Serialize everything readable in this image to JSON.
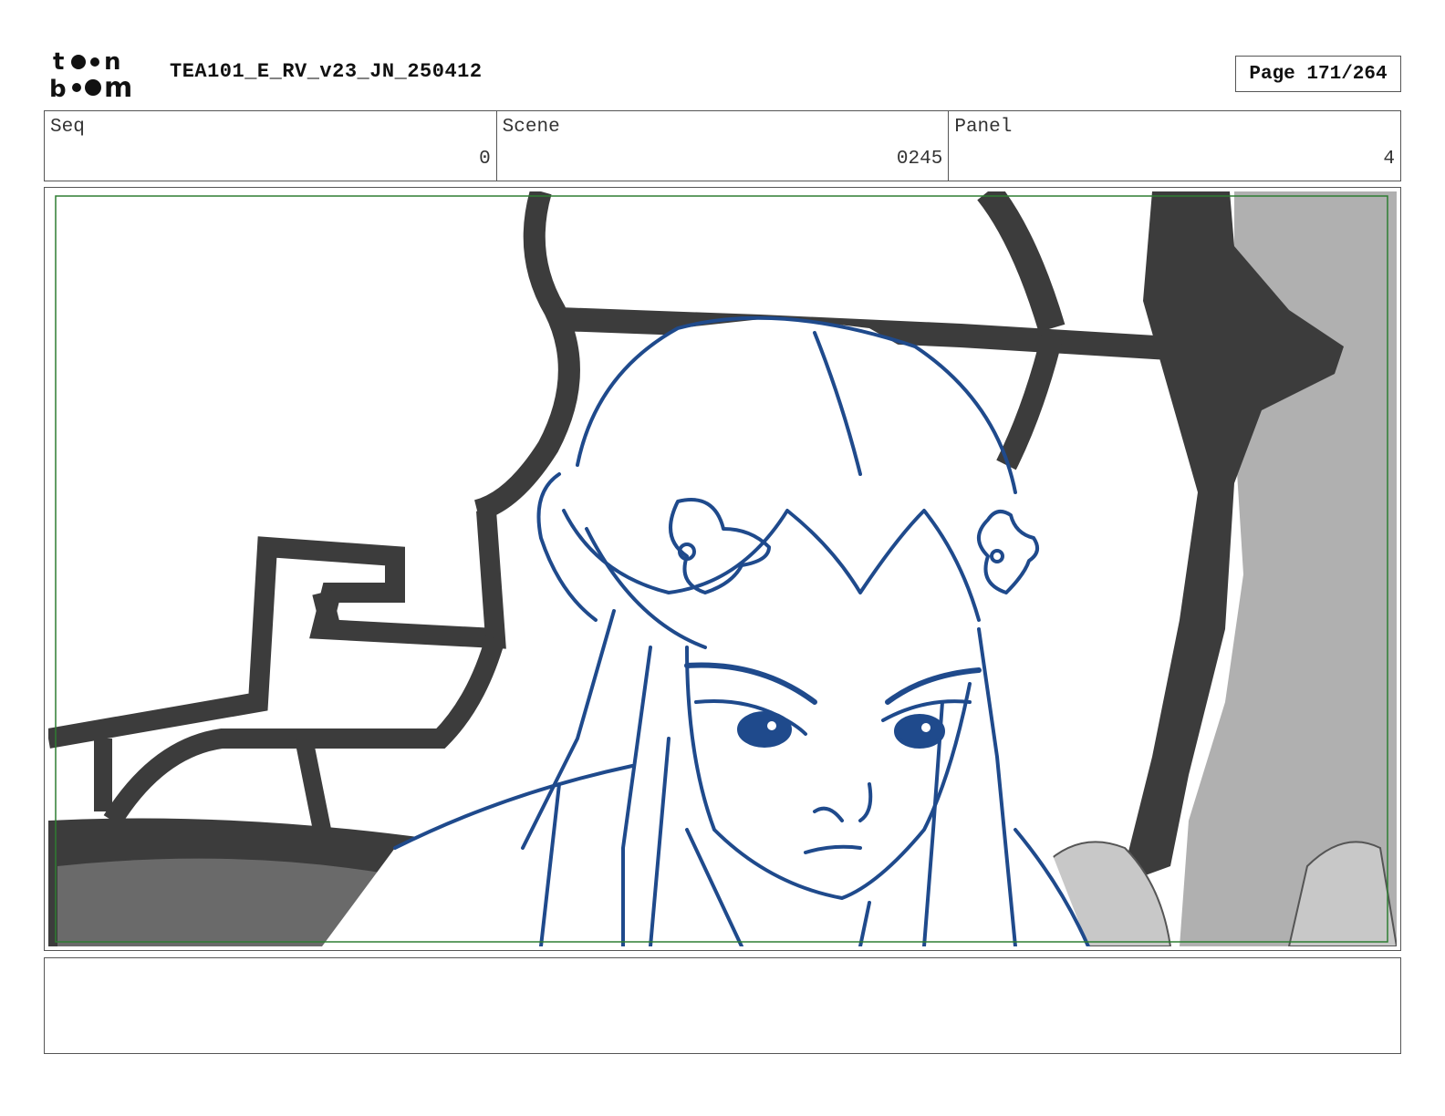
{
  "header": {
    "logo_text": "toon boom",
    "title": "TEA101_E_RV_v23_JN_250412",
    "page_label": "Page 171/264"
  },
  "info": {
    "seq_label": "Seq",
    "seq_value": "0",
    "scene_label": "Scene",
    "scene_value": "0245",
    "panel_label": "Panel",
    "panel_value": "4"
  },
  "colors": {
    "sketch_line": "#1f4a8c",
    "frame_guide": "#2e7d32",
    "background_gray": "#3c3c3c"
  },
  "notes": {
    "text": ""
  }
}
